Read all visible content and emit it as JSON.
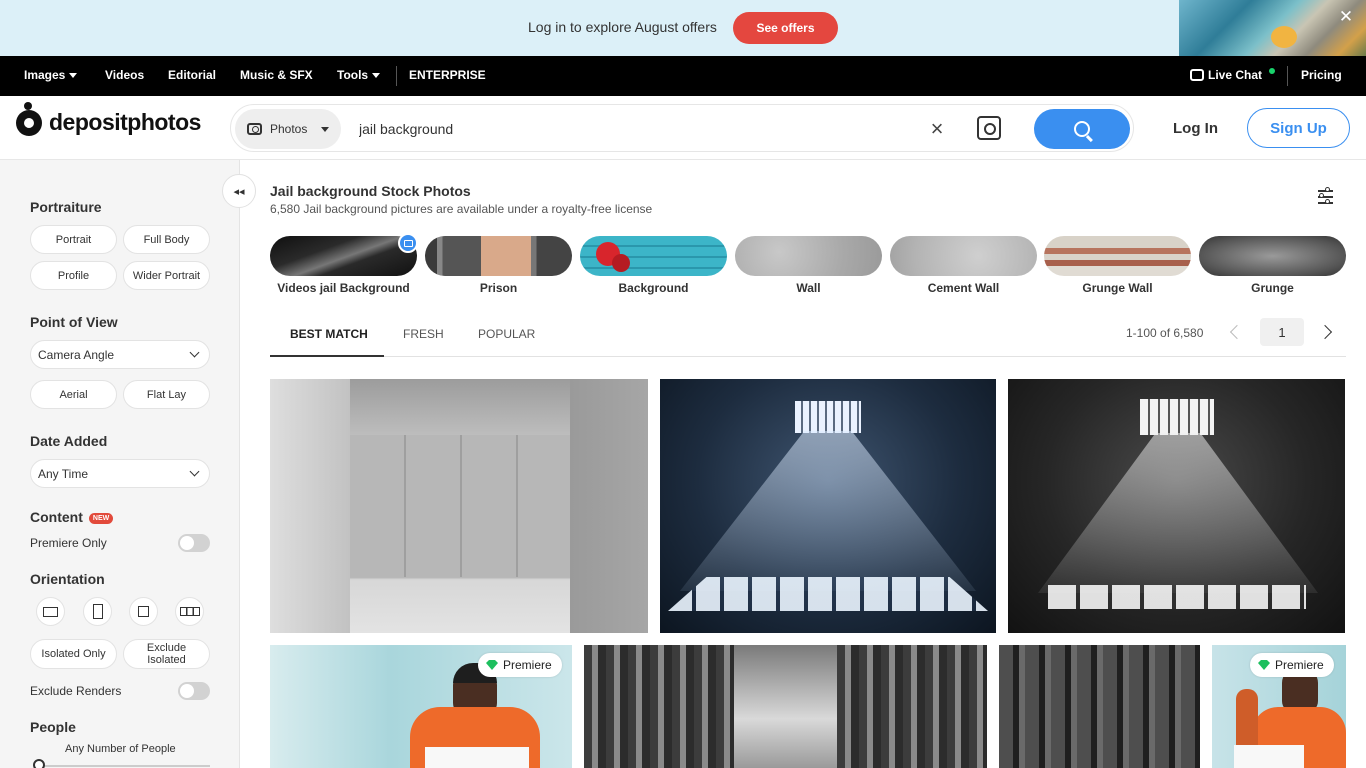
{
  "promo": {
    "text": "Log in to explore August offers",
    "button": "See offers",
    "close": "✕"
  },
  "topnav": {
    "images": "Images",
    "videos": "Videos",
    "editorial": "Editorial",
    "music": "Music & SFX",
    "tools": "Tools",
    "enterprise": "ENTERPRISE",
    "live_chat": "Live Chat",
    "pricing": "Pricing"
  },
  "header": {
    "logo": "depositphotos",
    "type": "Photos",
    "query": "jail background",
    "clear": "×",
    "login": "Log In",
    "signup": "Sign Up"
  },
  "sidebar": {
    "collapse": "◂◂",
    "portraiture": {
      "title": "Portraiture",
      "chips": [
        "Portrait",
        "Full Body",
        "Profile",
        "Wider Portrait"
      ]
    },
    "point_of_view": {
      "title": "Point of View",
      "dropdown": "Camera Angle",
      "chips": [
        "Aerial",
        "Flat Lay"
      ]
    },
    "date_added": {
      "title": "Date Added",
      "dropdown": "Any Time"
    },
    "content": {
      "title": "Content",
      "badge": "NEW",
      "premiere_only": "Premiere Only"
    },
    "orientation": {
      "title": "Orientation",
      "isolated_only": "Isolated Only",
      "exclude_isolated": "Exclude Isolated",
      "exclude_renders": "Exclude Renders"
    },
    "people": {
      "title": "People",
      "any_number": "Any Number of People"
    }
  },
  "main": {
    "title": "Jail background Stock Photos",
    "subtitle": "6,580 Jail background pictures are available under a royalty-free license",
    "related": [
      "Videos jail Background",
      "Prison",
      "Background",
      "Wall",
      "Cement Wall",
      "Grunge Wall",
      "Grunge"
    ],
    "tabs": [
      "BEST MATCH",
      "FRESH",
      "POPULAR"
    ],
    "pager": {
      "count": "1-100 of 6,580",
      "page": "1"
    },
    "premiere_label": "Premiere"
  },
  "colors": {
    "accent": "#3a8ff0",
    "promo_button": "#e4473f",
    "premiere_gem": "#1dbf5e",
    "live_chat_dot": "#19d26b"
  }
}
